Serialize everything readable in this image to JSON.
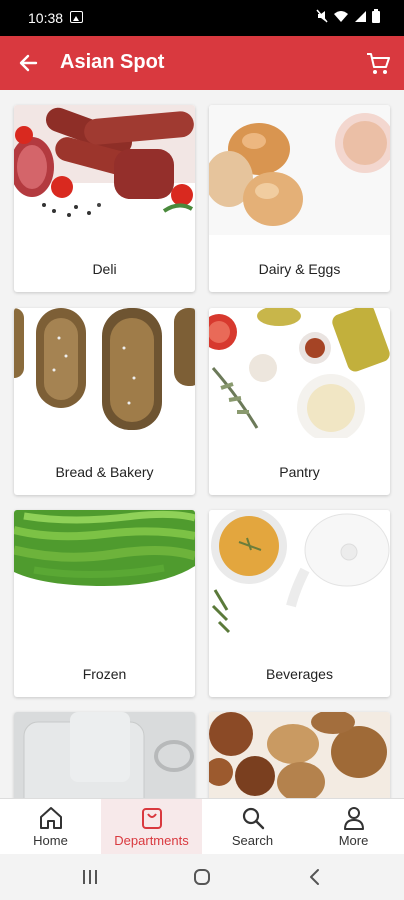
{
  "status_bar": {
    "time": "10:38"
  },
  "app_bar": {
    "title": "Asian Spot"
  },
  "departments": [
    {
      "label": "Deli"
    },
    {
      "label": "Dairy & Eggs"
    },
    {
      "label": "Bread & Bakery"
    },
    {
      "label": "Pantry"
    },
    {
      "label": "Frozen"
    },
    {
      "label": "Beverages"
    },
    {
      "label": ""
    },
    {
      "label": ""
    }
  ],
  "bottom_nav": {
    "items": [
      {
        "label": "Home",
        "icon": "home-icon"
      },
      {
        "label": "Departments",
        "icon": "bag-icon",
        "active": true
      },
      {
        "label": "Search",
        "icon": "search-icon"
      },
      {
        "label": "More",
        "icon": "person-icon"
      }
    ]
  },
  "colors": {
    "accent": "#d9393f",
    "active_bg": "#f7e9ea"
  }
}
